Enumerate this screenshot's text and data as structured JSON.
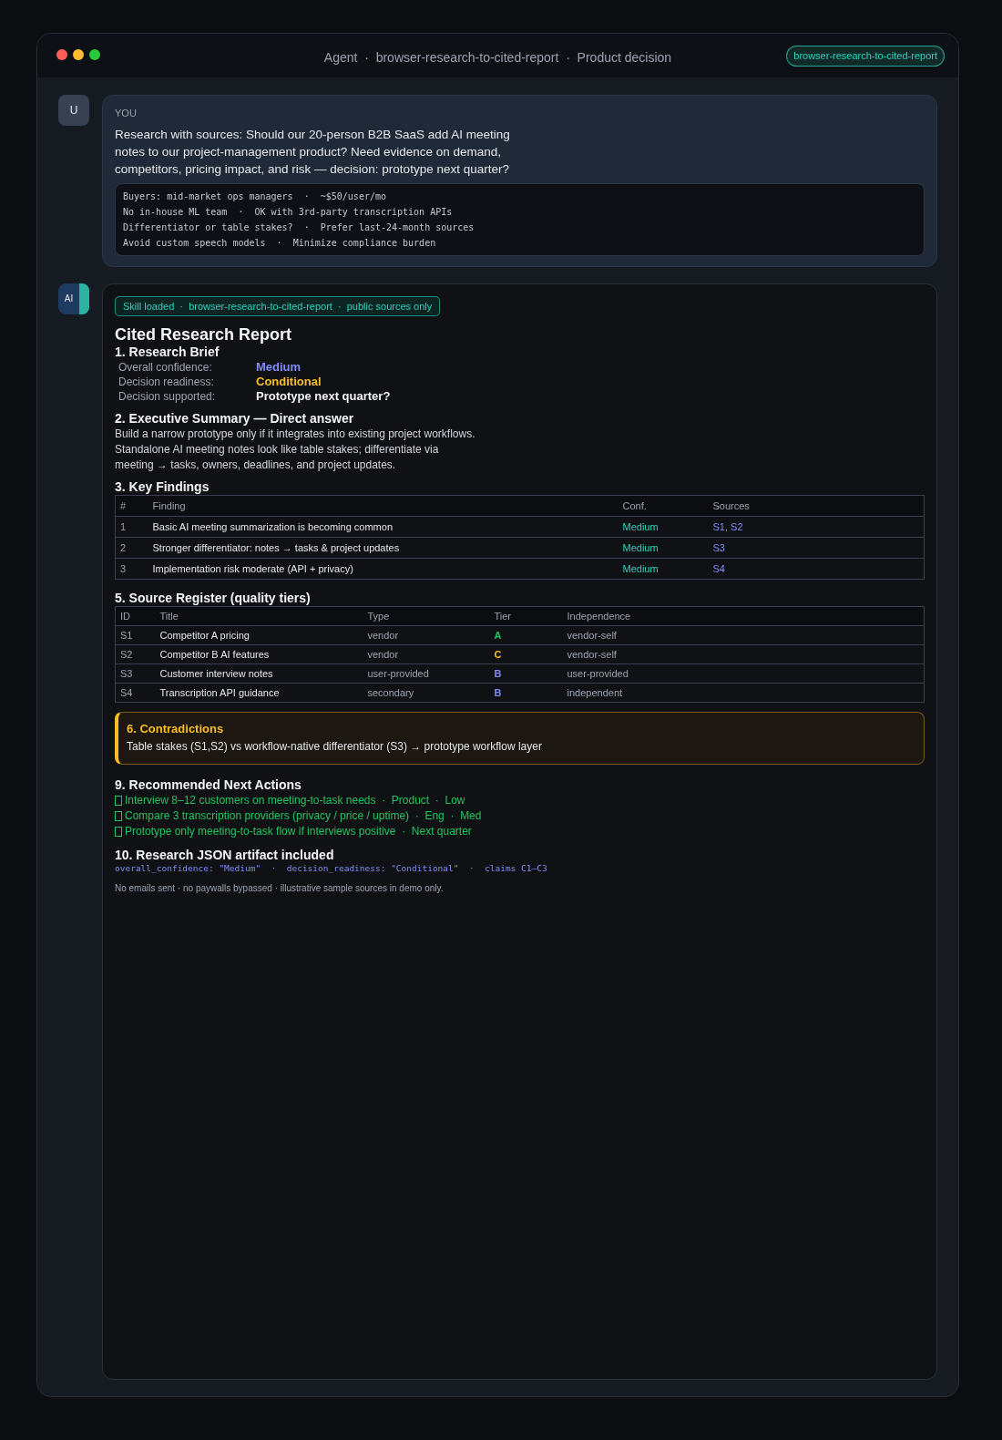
{
  "window": {
    "title": "Agent  ·  browser-research-to-cited-report  ·  Product decision",
    "badge": "browser-research-to-cited-report"
  },
  "user_message": {
    "avatar": "U",
    "label": "YOU",
    "text": "Research with sources: Should our 20-person B2B SaaS add AI meeting notes to our project-management product? Need evidence on demand, competitors, pricing impact, and risk — decision: prototype next quarter?",
    "constraints": [
      "Buyers: mid-market ops managers  ·  ~$50/user/mo",
      "No in-house ML team  ·  OK with 3rd-party transcription APIs",
      "Differentiator or table stakes?  ·  Prefer last-24-month sources",
      "Avoid custom speech models  ·  Minimize compliance burden"
    ]
  },
  "agent_message": {
    "avatar": "AI",
    "skill_badge": "Skill loaded  ·  browser-research-to-cited-report  ·  public sources only",
    "report_title": "Cited Research Report",
    "brief": {
      "heading": "1. Research Brief",
      "rows": [
        {
          "label": "Overall confidence:",
          "value": "Medium",
          "color": "#818cf8"
        },
        {
          "label": "Decision readiness:",
          "value": "Conditional",
          "color": "#fbbf24"
        },
        {
          "label": "Decision supported:",
          "value": "Prototype next quarter?",
          "color": "#f3f4f6"
        }
      ]
    },
    "summary": {
      "heading": "2. Executive Summary — Direct answer",
      "lines": [
        "Build a narrow prototype only if it integrates into existing project workflows.",
        "Standalone AI meeting notes look like table stakes; differentiate via",
        "meeting → tasks, owners, deadlines, and project updates."
      ]
    },
    "findings": {
      "heading": "3. Key Findings",
      "columns": [
        "#",
        "Finding",
        "Conf.",
        "Sources"
      ],
      "rows": [
        [
          "1",
          "Basic AI meeting summarization is becoming common",
          "Medium",
          "S1, S2"
        ],
        [
          "2",
          "Stronger differentiator: notes → tasks & project updates",
          "Medium",
          "S3"
        ],
        [
          "3",
          "Implementation risk moderate (API + privacy)",
          "Medium",
          "S4"
        ]
      ]
    },
    "sources": {
      "heading": "5. Source Register (quality tiers)",
      "columns": [
        "ID",
        "Title",
        "Type",
        "Tier",
        "Independence"
      ],
      "rows": [
        {
          "id": "S1",
          "title": "Competitor A pricing",
          "type": "vendor",
          "tier": "A",
          "color": "#22c55e",
          "independence": "vendor-self"
        },
        {
          "id": "S2",
          "title": "Competitor B AI features",
          "type": "vendor",
          "tier": "C",
          "color": "#fbbf24",
          "independence": "vendor-self"
        },
        {
          "id": "S3",
          "title": "Customer interview notes",
          "type": "user-provided",
          "tier": "B",
          "color": "#818cf8",
          "independence": "user-provided"
        },
        {
          "id": "S4",
          "title": "Transcription API guidance",
          "type": "secondary",
          "tier": "B",
          "color": "#818cf8",
          "independence": "independent"
        }
      ]
    },
    "contradictions": {
      "heading": "6. Contradictions",
      "text": "Table stakes (S1,S2) vs workflow-native differentiator (S3) → prototype workflow layer"
    },
    "actions": {
      "heading": "9. Recommended Next Actions",
      "items": [
        "Interview 8–12 customers on meeting-to-task needs  ·  Product  ·  Low",
        "Compare 3 transcription providers (privacy / price / uptime)  ·  Eng  ·  Med",
        "Prototype only meeting-to-task flow if interviews positive  ·  Next quarter"
      ]
    },
    "artifact": {
      "heading": "10. Research JSON artifact included",
      "code": "overall_confidence: \"Medium\"  ·  decision_readiness: \"Conditional\"  ·  claims C1–C3"
    },
    "footer": "No emails sent · no paywalls bypassed · illustrative sample sources in demo only."
  }
}
